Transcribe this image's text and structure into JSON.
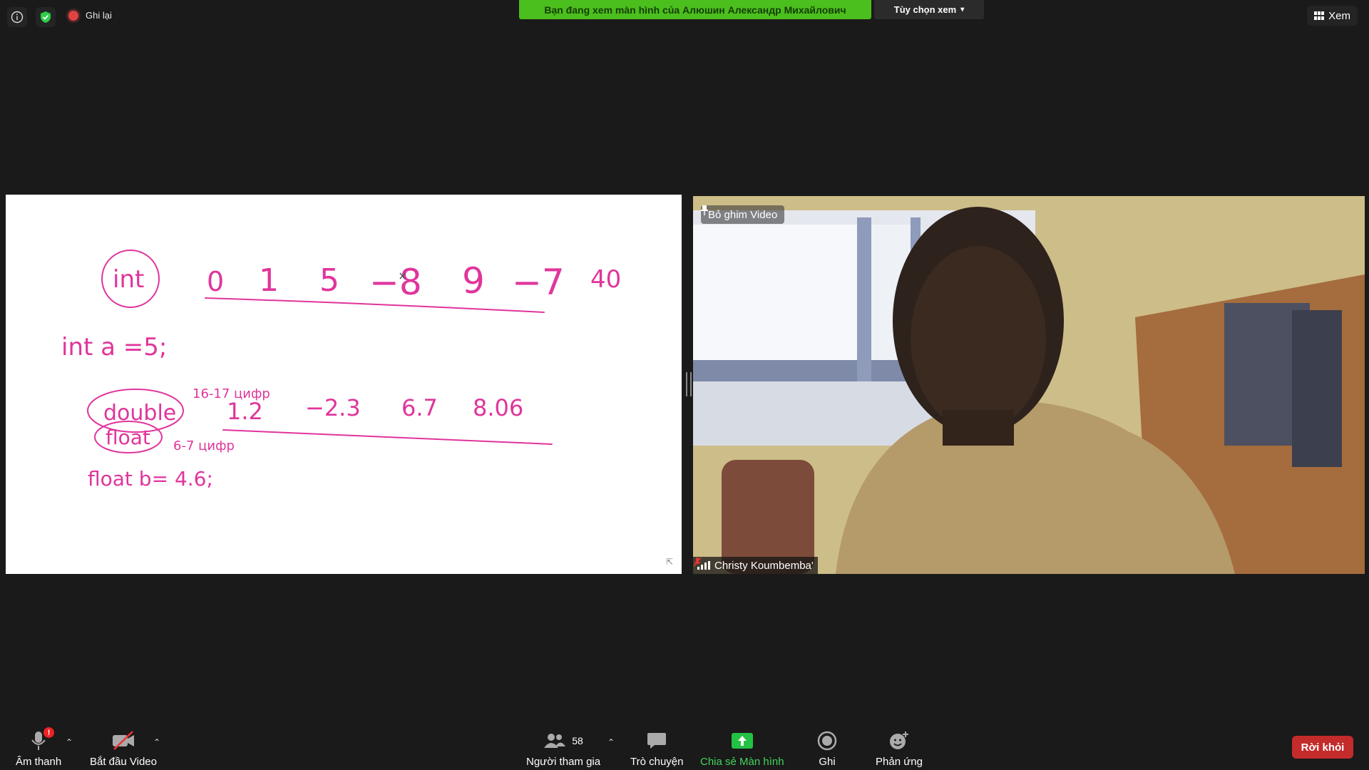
{
  "top_bar": {
    "record_label": "Ghi lại",
    "share_banner": "Bạn đang xem màn hình của Алюшин Александр Михайлович",
    "view_options_label": "Tùy chọn xem",
    "view_label": "Xem"
  },
  "shared_screen": {
    "line1": [
      "int",
      "0",
      "1",
      "5",
      "−8",
      "9",
      "−7",
      "40"
    ],
    "line2": "int a =5;",
    "line3_label": "double",
    "line3_note": "16-17 цифр",
    "line3_values": [
      "1.2",
      "−2.3",
      "6.7",
      "8.06"
    ],
    "line4_label": "float",
    "line4_note": "6-7 цифр",
    "line5": "float b= 4.6;"
  },
  "video": {
    "pin_label": "Bỏ ghim Video",
    "participant_name": "Christy Koumbemba'"
  },
  "toolbar": {
    "audio_label": "Âm thanh",
    "audio_badge": "!",
    "video_label": "Bắt đầu Video",
    "participants_label": "Người tham gia",
    "participants_count": "58",
    "chat_label": "Trò chuyện",
    "share_label": "Chia sẻ Màn hình",
    "record_label": "Ghi",
    "reactions_label": "Phản ứng",
    "leave_label": "Rời khỏi"
  },
  "colors": {
    "share_banner": "#4bbf1d",
    "leave_button": "#c42b2b",
    "ink": "#e0359c",
    "share_screen_accent": "#43d45b"
  }
}
